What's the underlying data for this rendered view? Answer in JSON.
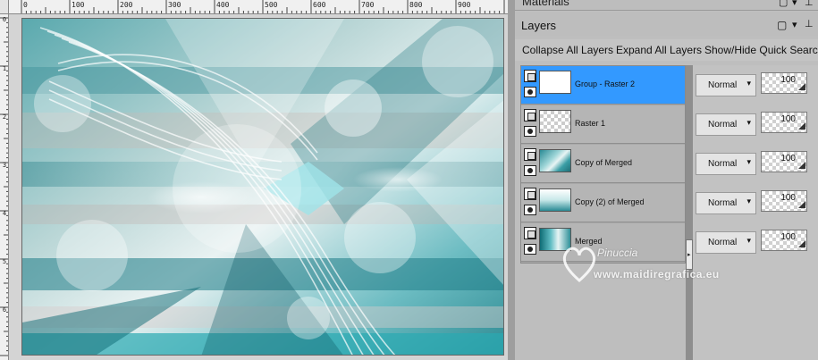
{
  "ruler": {
    "top_labels": [
      "0",
      "100",
      "200",
      "300",
      "400",
      "500",
      "600",
      "700",
      "800",
      "900"
    ],
    "left_labels": [
      "0",
      "1",
      "2",
      "3",
      "4",
      "5",
      "6"
    ]
  },
  "materials_panel": {
    "title": "Materials"
  },
  "layers_panel": {
    "title": "Layers",
    "toolbar": {
      "collapse_all": "Collapse All Layers",
      "expand_all": "Expand All Layers",
      "show_hide_quick_search": "Show/Hide Quick Search"
    },
    "layers": [
      {
        "name": "Group - Raster 2",
        "selected": true,
        "thumbnail": "white",
        "blend_mode": "Normal",
        "opacity": "100"
      },
      {
        "name": "Raster 1",
        "selected": false,
        "thumbnail": "transparent",
        "blend_mode": "Normal",
        "opacity": "100"
      },
      {
        "name": "Copy of Merged",
        "selected": false,
        "thumbnail": "teal-image",
        "blend_mode": "Normal",
        "opacity": "100"
      },
      {
        "name": "Copy (2) of Merged",
        "selected": false,
        "thumbnail": "teal-image",
        "blend_mode": "Normal",
        "opacity": "100"
      },
      {
        "name": "Merged",
        "selected": false,
        "thumbnail": "teal-image",
        "blend_mode": "Normal",
        "opacity": "100"
      }
    ]
  },
  "watermark": {
    "name": "Pinuccia",
    "url": "www.maidiregrafica.eu"
  },
  "colors": {
    "selection": "#3399ff",
    "teal_dark": "#1f6f77",
    "teal_light": "#9fd6d8"
  }
}
